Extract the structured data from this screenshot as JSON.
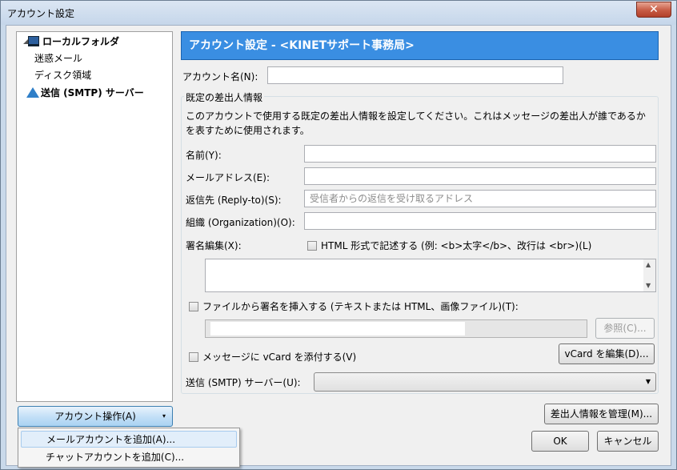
{
  "window": {
    "title": "アカウント設定",
    "close_glyph": "✕"
  },
  "tree": {
    "items": [
      {
        "label": "ローカルフォルダ",
        "bold": true,
        "icon": "monitor-icon"
      },
      {
        "label": "迷惑メール",
        "bold": false
      },
      {
        "label": "ディスク領域",
        "bold": false
      },
      {
        "label": "送信 (SMTP) サーバー",
        "bold": true,
        "icon": "server-icon"
      }
    ]
  },
  "account_action": {
    "label": "アカウント操作(A)",
    "arrow": "▾"
  },
  "menu": {
    "items": [
      {
        "label": "メールアカウントを追加(A)..."
      },
      {
        "label": "チャットアカウントを追加(C)..."
      }
    ]
  },
  "header": {
    "title": "アカウント設定 - <KINETサポート事務局>"
  },
  "account_name": {
    "label": "アカウント名(N):",
    "value": ""
  },
  "identity": {
    "group_title": "既定の差出人情報",
    "description": "このアカウントで使用する既定の差出人情報を設定してください。これはメッセージの差出人が誰であるかを表すために使用されます。",
    "name_label": "名前(Y):",
    "email_label": "メールアドレス(E):",
    "reply_label": "返信先 (Reply-to)(S):",
    "reply_placeholder": "受信者からの返信を受け取るアドレス",
    "org_label": "組織 (Organization)(O):",
    "sig_label": "署名編集(X):",
    "html_check_label": "HTML 形式で記述する (例: <b>太字</b>、改行は <br>)(L)",
    "file_check_label": "ファイルから署名を挿入する (テキストまたは HTML、画像ファイル)(T):",
    "browse_button": "参照(C)...",
    "vcard_check_label": "メッセージに vCard を添付する(V)",
    "vcard_button": "vCard を編集(D)...",
    "smtp_label": "送信 (SMTP) サーバー(U):"
  },
  "buttons": {
    "manage_identities": "差出人情報を管理(M)...",
    "ok": "OK",
    "cancel": "キャンセル"
  }
}
